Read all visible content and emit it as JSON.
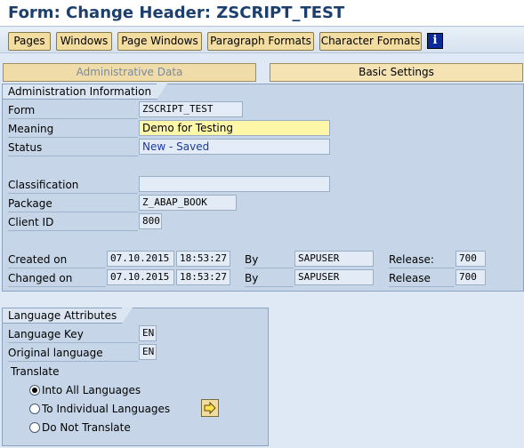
{
  "header": {
    "title": "Form: Change Header: ZSCRIPT_TEST"
  },
  "toolbar": {
    "pages": "Pages",
    "windows": "Windows",
    "page_windows": "Page Windows",
    "paragraph_formats": "Paragraph Formats",
    "character_formats": "Character Formats",
    "info_icon": "i"
  },
  "tabs": {
    "admin": "Administrative Data",
    "basic": "Basic Settings"
  },
  "admin": {
    "group_title": "Administration Information",
    "form_label": "Form",
    "form_value": "ZSCRIPT_TEST",
    "meaning_label": "Meaning",
    "meaning_value": "Demo for Testing",
    "status_label": "Status",
    "status_value": "New - Saved",
    "classification_label": "Classification",
    "classification_value": "",
    "package_label": "Package",
    "package_value": "Z_ABAP_BOOK",
    "client_label": "Client ID",
    "client_value": "800",
    "created_label": "Created on",
    "created_date": "07.10.2015",
    "created_time": "18:53:27",
    "created_by_label": "By",
    "created_by": "SAPUSER",
    "created_release_label": "Release:",
    "created_release": "700",
    "changed_label": "Changed on",
    "changed_date": "07.10.2015",
    "changed_time": "18:53:27",
    "changed_by_label": "By",
    "changed_by": "SAPUSER",
    "changed_release_label": "Release",
    "changed_release": "700"
  },
  "language": {
    "group_title": "Language Attributes",
    "key_label": "Language Key",
    "key_value": "EN",
    "orig_label": "Original language",
    "orig_value": "EN",
    "translate_label": "Translate",
    "options": [
      "Into All Languages",
      "To Individual Languages",
      "Do Not Translate"
    ],
    "selected_option": "Into All Languages"
  },
  "colors": {
    "title": "#1c3f6e",
    "button": "#f2dca0",
    "group_bg": "#c6d6e8",
    "edit_field": "#fff7a8"
  },
  "icons": {
    "info": "info-icon",
    "arrow": "arrow-right-icon"
  }
}
